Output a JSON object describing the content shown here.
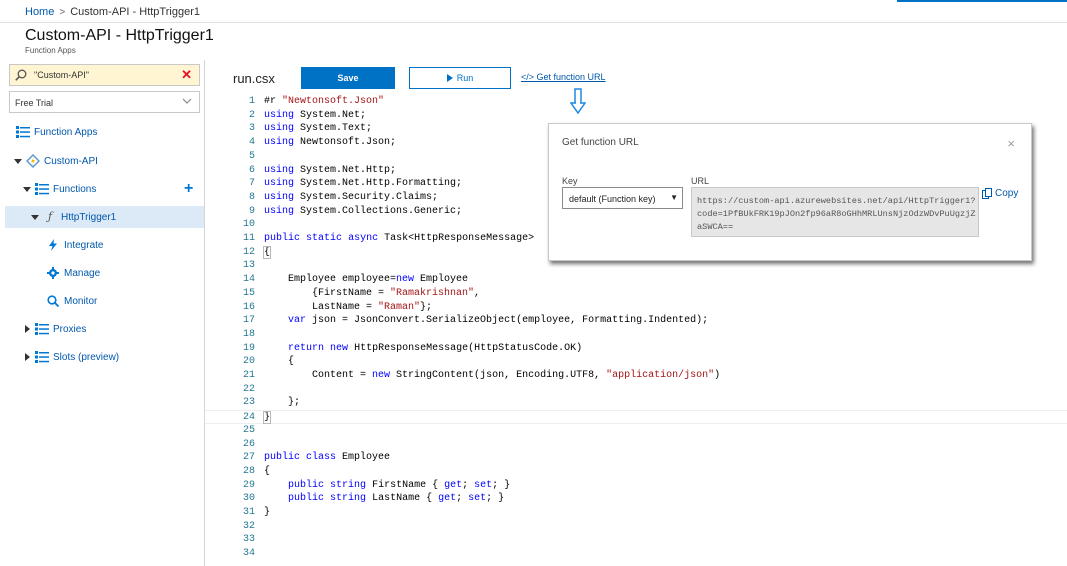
{
  "breadcrumb": {
    "home": "Home",
    "sep": ">",
    "current": "Custom-API - HttpTrigger1"
  },
  "header": {
    "title": "Custom-API - HttpTrigger1",
    "subtitle": "Function Apps"
  },
  "sidebar": {
    "search_value": "\"Custom-API\"",
    "subscription": "Free Trial",
    "items": [
      {
        "label": "Function Apps"
      },
      {
        "label": "Custom-API"
      },
      {
        "label": "Functions"
      },
      {
        "label": "HttpTrigger1"
      },
      {
        "label": "Integrate"
      },
      {
        "label": "Manage"
      },
      {
        "label": "Monitor"
      },
      {
        "label": "Proxies"
      },
      {
        "label": "Slots (preview)"
      }
    ],
    "add_glyph": "+"
  },
  "toolbar": {
    "file_name": "run.csx",
    "save_label": "Save",
    "run_label": "Run",
    "get_url_label": "</> Get function URL"
  },
  "editor": {
    "lines": [
      "#r \"Newtonsoft.Json\"",
      "using System.Net;",
      "using System.Text;",
      "using Newtonsoft.Json;",
      "",
      "using System.Net.Http;",
      "using System.Net.Http.Formatting;",
      "using System.Security.Claims;",
      "using System.Collections.Generic;",
      "",
      "public static async Task<HttpResponseMessage>",
      "{",
      "",
      "    Employee employee=new Employee",
      "        {FirstName = \"Ramakrishnan\",",
      "        LastName = \"Raman\"};",
      "    var json = JsonConvert.SerializeObject(employee, Formatting.Indented);",
      "",
      "    return new HttpResponseMessage(HttpStatusCode.OK)",
      "    {",
      "        Content = new StringContent(json, Encoding.UTF8, \"application/json\")",
      "",
      "    };",
      "}",
      "",
      "",
      "public class Employee",
      "{",
      "    public string FirstName { get; set; }",
      "    public string LastName { get; set; }",
      "}",
      "",
      "",
      ""
    ]
  },
  "modal": {
    "title": "Get function URL",
    "close_glyph": "×",
    "key_label": "Key",
    "key_value": "default (Function key)",
    "url_label": "URL",
    "url_value": "https://custom-api.azurewebsites.net/api/HttpTrigger1?code=1PfBUkFRK19pJOn2fp96aR8oGHhMRLUnsNjzOdzWDvPuUgzjZaSWCA==",
    "copy_label": "Copy"
  },
  "colors": {
    "accent": "#0072c6",
    "link": "#0058ad",
    "search_bg": "#fff5d2",
    "clear_red": "#e81123",
    "selected_bg": "#dce9f7"
  },
  "icons": [
    "search-icon",
    "close-icon",
    "chevron-down-icon",
    "list-icon",
    "lightning-icon",
    "function-icon",
    "gear-icon",
    "play-icon",
    "copy-icon",
    "arrow-down-icon"
  ]
}
